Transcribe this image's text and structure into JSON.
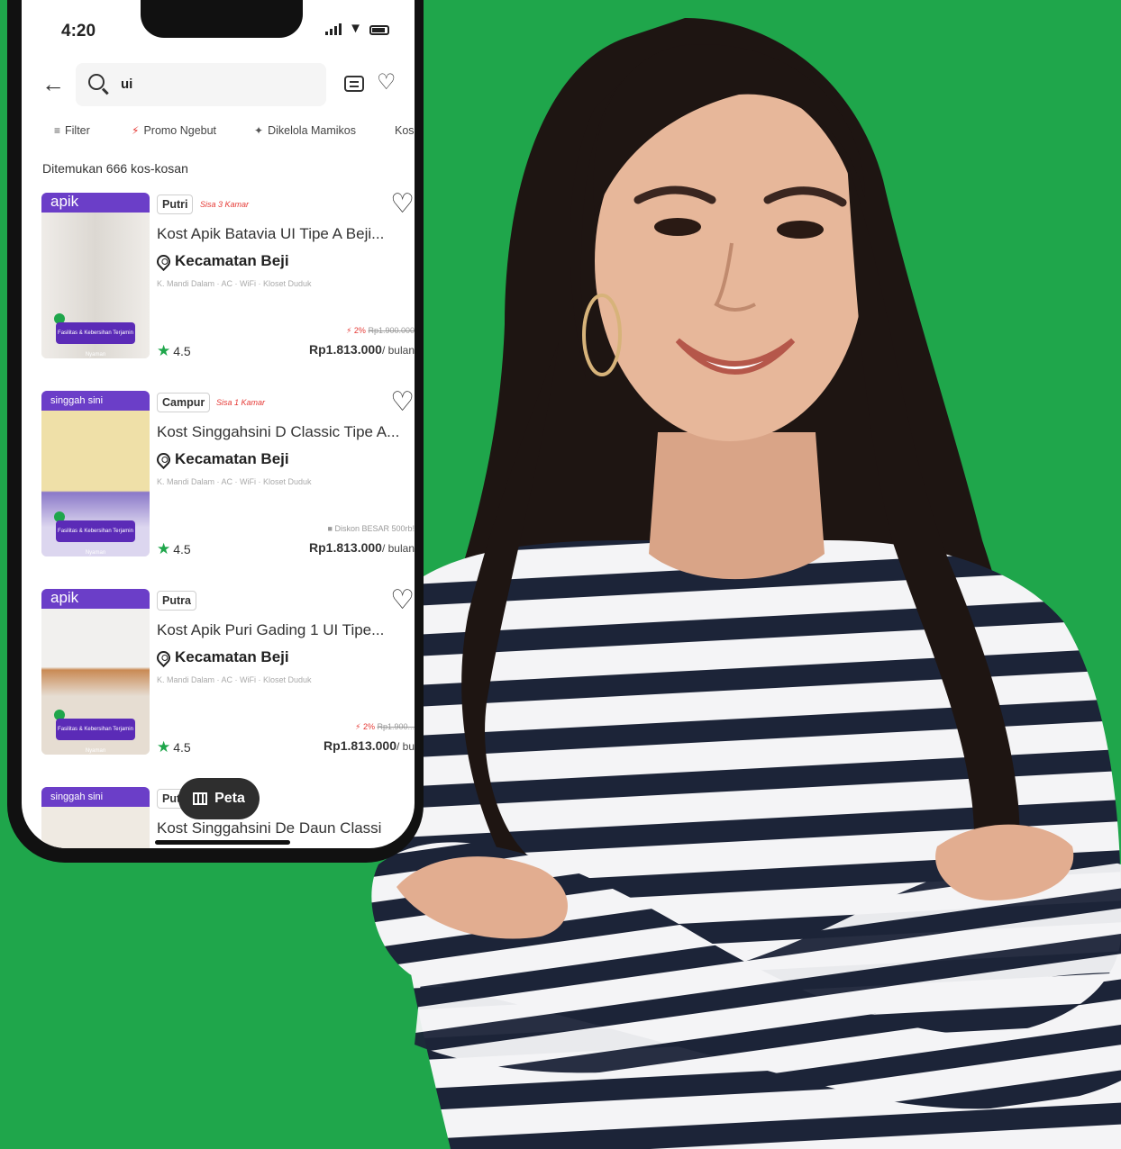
{
  "status_bar": {
    "time": "4:20"
  },
  "search": {
    "value": "ui"
  },
  "filters": [
    {
      "label": "Filter",
      "icon": "filter-icon"
    },
    {
      "label": "Promo Ngebut",
      "icon": "lightning-icon"
    },
    {
      "label": "Dikelola Mamikos",
      "icon": "sparkle-icon"
    },
    {
      "label": "Kos"
    }
  ],
  "result_count": "Ditemukan 666 kos-kosan",
  "listings": [
    {
      "brand": "apik",
      "gender": "Putri",
      "rooms_left": "Sisa 3 Kamar",
      "title": "Kost Apik Batavia UI Tipe A Beji...",
      "location": "Kecamatan Beji",
      "facilities": "K. Mandi Dalam · AC · WiFi · Kloset Duduk",
      "promo_discount": "2%",
      "promo_original": "Rp1.900.000",
      "rating": "4.5",
      "price": "Rp1.813.000",
      "price_unit": "/ bulan",
      "guarantee": "Fasilitas & Kebersihan Terjamin Nyaman"
    },
    {
      "brand": "singgah sini",
      "gender": "Campur",
      "rooms_left": "Sisa 1 Kamar",
      "title": "Kost Singgahsini D Classic Tipe A...",
      "location": "Kecamatan Beji",
      "facilities": "K. Mandi Dalam · AC · WiFi · Kloset Duduk",
      "promo_discount": "",
      "promo_original": "Diskon BESAR 500rb!",
      "rating": "4.5",
      "price": "Rp1.813.000",
      "price_unit": "/ bulan",
      "guarantee": "Fasilitas & Kebersihan Terjamin Nyaman"
    },
    {
      "brand": "apik",
      "gender": "Putra",
      "rooms_left": "",
      "title": "Kost Apik Puri Gading 1 UI Tipe...",
      "location": "Kecamatan Beji",
      "facilities": "K. Mandi Dalam · AC · WiFi · Kloset Duduk",
      "promo_discount": "2%",
      "promo_original": "Rp1.900...",
      "rating": "4.5",
      "price": "Rp1.813.000",
      "price_unit": "/ bu",
      "guarantee": "Fasilitas & Kebersihan Terjamin Nyaman"
    },
    {
      "brand": "singgah sini",
      "gender": "Put",
      "title": "Kost Singgahsini De Daun Classi"
    }
  ],
  "map_button": "Peta",
  "colors": {
    "background": "#1fa64b",
    "brand_purple": "#6b3ec8",
    "accent_red": "#e53935"
  }
}
